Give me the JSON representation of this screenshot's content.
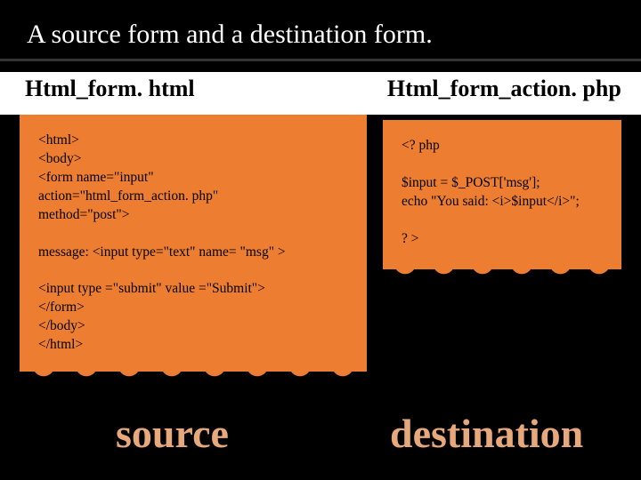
{
  "title": "A source form and a destination form.",
  "left": {
    "heading": "Html_form. html",
    "code": "<html>\n<body>\n<form name=\"input\"\naction=\"html_form_action. php\"\nmethod=\"post\">\n\nmessage: <input type=\"text\" name= \"msg\" >\n\n<input type =\"submit\" value =\"Submit\">\n</form>\n</body>\n</html>"
  },
  "right": {
    "heading": "Html_form_action. php",
    "code": "<? php\n\n$input = $_POST['msg'];\necho \"You said: <i>$input</i>\";\n\n? >"
  },
  "labels": {
    "source": "source",
    "destination": "destination"
  }
}
